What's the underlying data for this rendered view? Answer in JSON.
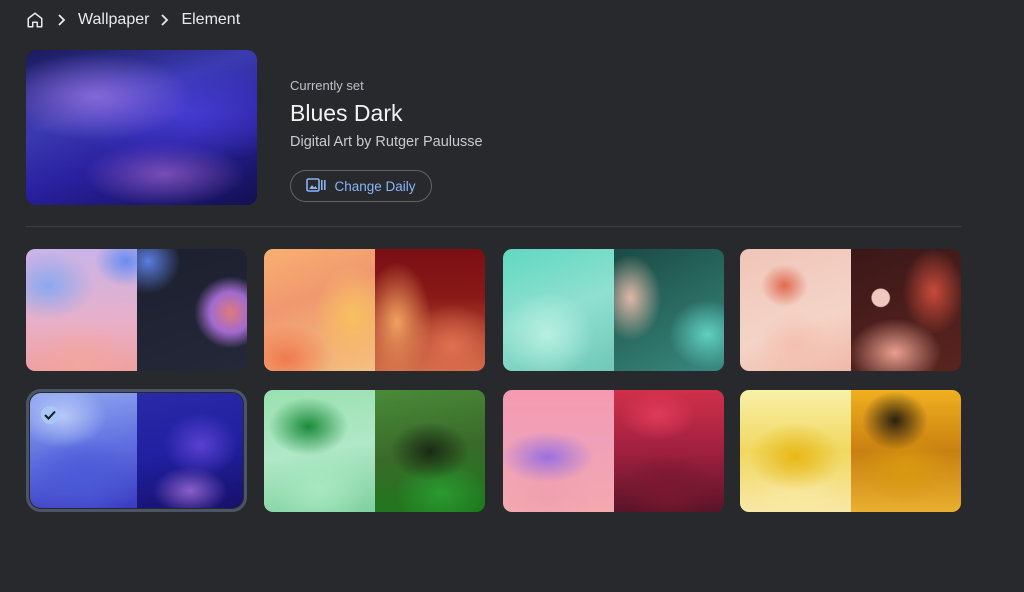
{
  "breadcrumb": {
    "home_icon": "home-icon",
    "items": [
      "Wallpaper",
      "Element"
    ]
  },
  "current": {
    "label": "Currently set",
    "title": "Blues Dark",
    "credit": "Digital Art by Rutger Paulusse",
    "change_button": "Change Daily",
    "change_icon": "image-sequence-icon"
  },
  "wallpapers": [
    {
      "name": "lavender-glass",
      "selected": false
    },
    {
      "name": "orange-ribbon",
      "selected": false
    },
    {
      "name": "teal-fold",
      "selected": false
    },
    {
      "name": "coral-shapes",
      "selected": false
    },
    {
      "name": "blues",
      "selected": true
    },
    {
      "name": "green-wave",
      "selected": false
    },
    {
      "name": "pink-wave",
      "selected": false
    },
    {
      "name": "yellow-wave",
      "selected": false
    }
  ],
  "colors": {
    "background": "#28292c",
    "accent": "#8ab4f8",
    "check": "#a8c7fa"
  }
}
